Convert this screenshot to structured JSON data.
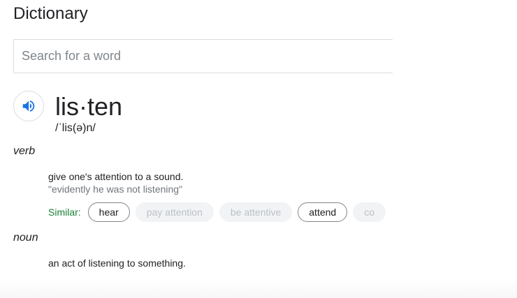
{
  "app": {
    "title": "Dictionary"
  },
  "search": {
    "placeholder": "Search for a word",
    "value": ""
  },
  "entry": {
    "audio_icon": "speaker-icon",
    "word": "lis·ten",
    "phonetic": "/ˈlis(ə)n/",
    "senses": [
      {
        "part_of_speech": "verb",
        "definition": "give one's attention to a sound.",
        "example": "\"evidently he was not listening\"",
        "similar_label": "Similar:",
        "similar": [
          {
            "label": "hear",
            "state": "active"
          },
          {
            "label": "pay attention",
            "state": "muted"
          },
          {
            "label": "be attentive",
            "state": "muted"
          },
          {
            "label": "attend",
            "state": "active"
          },
          {
            "label": "co",
            "state": "muted"
          }
        ]
      },
      {
        "part_of_speech": "noun",
        "definition": "an act of listening to something."
      }
    ]
  },
  "colors": {
    "similar_label": "#188038",
    "speaker_icon": "#1a73e8",
    "muted_chip_text": "#bdc1c6"
  }
}
